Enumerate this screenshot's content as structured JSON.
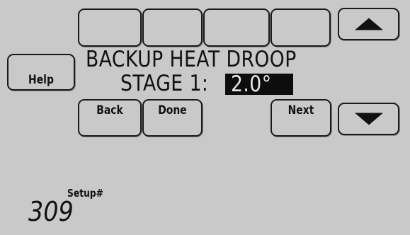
{
  "message": {
    "line1": "BACKUP HEAT DROOP",
    "line2": "STAGE 1:",
    "value": "2.0°"
  },
  "buttons": {
    "help": "Help",
    "back": "Back",
    "done": "Done",
    "next": "Next"
  },
  "icons": {
    "up": "up-arrow-icon",
    "down": "down-arrow-icon"
  },
  "setup": {
    "label": "Setup#",
    "number": "309"
  },
  "colors": {
    "screen_bg": "#c9c9c9",
    "text": "#111111",
    "highlight_bg": "#0d0d0d",
    "highlight_text": "#e8e8e8"
  }
}
